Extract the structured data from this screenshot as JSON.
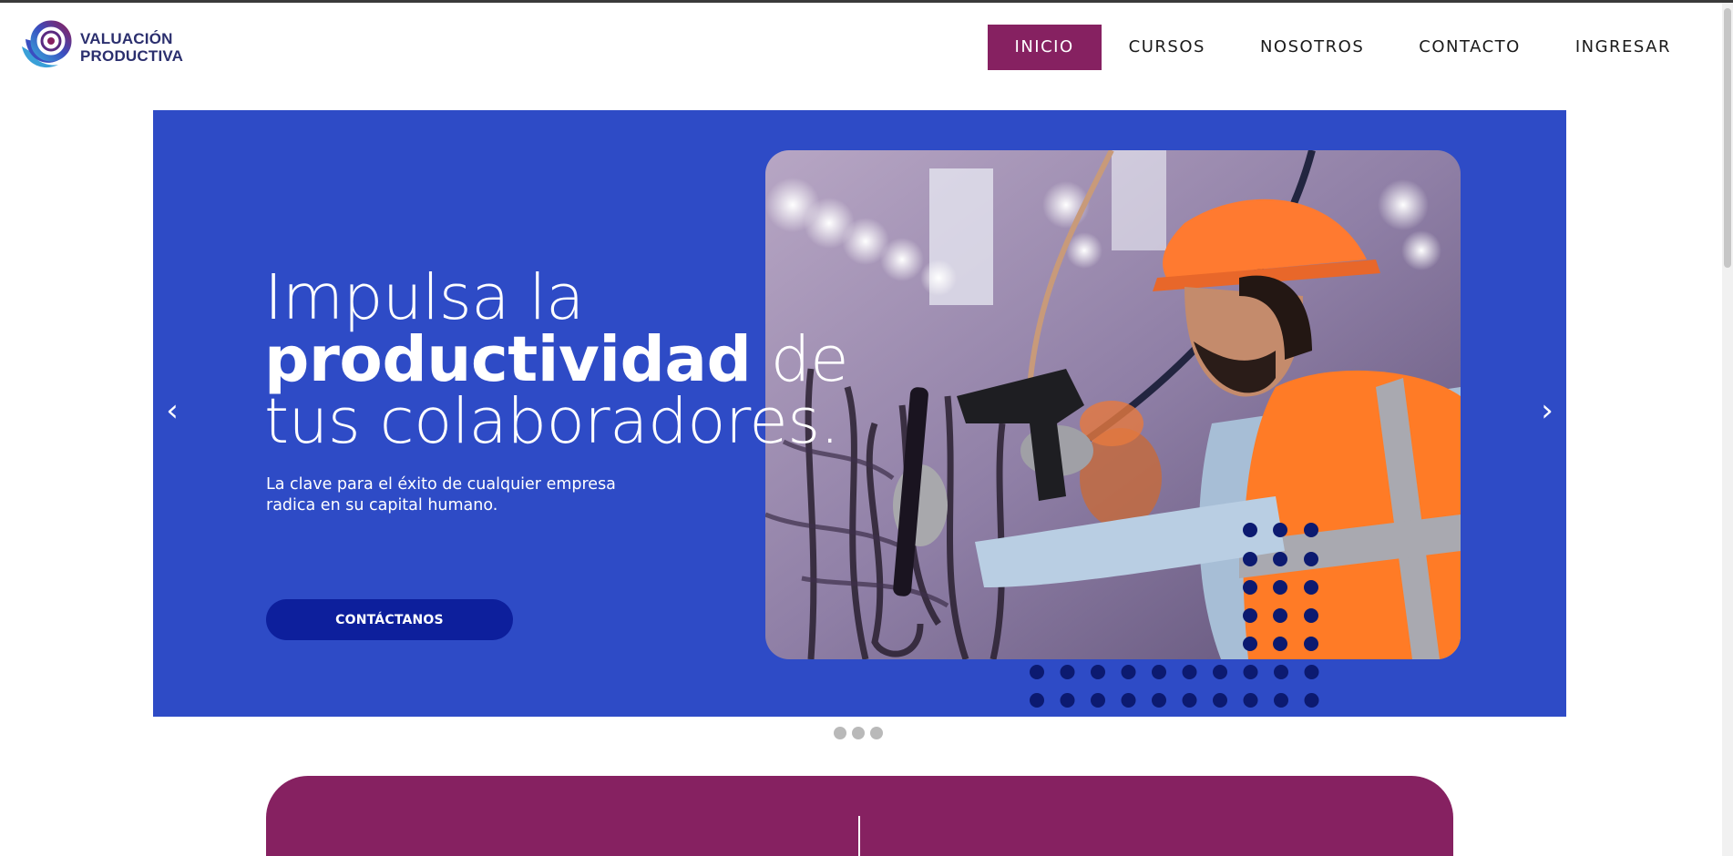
{
  "header": {
    "logo_line1": "VALUACIÓN",
    "logo_line2": "PRODUCTIVA",
    "nav": [
      {
        "label": "INICIO",
        "active": true
      },
      {
        "label": "CURSOS",
        "active": false
      },
      {
        "label": "NOSOTROS",
        "active": false
      },
      {
        "label": "CONTACTO",
        "active": false
      },
      {
        "label": "INGRESAR",
        "active": false
      }
    ]
  },
  "hero": {
    "title_line1": "Impulsa la",
    "title_bold": "productividad",
    "title_after_bold": " de",
    "title_line3": "tus colaboradores.",
    "subtitle_line1": "La clave para el éxito de cualquier empresa",
    "subtitle_line2": "radica en su capital humano.",
    "cta_label": "CONTÁCTANOS",
    "prev_arrow": "‹",
    "next_arrow": "›",
    "image": "worker-with-hard-hat-and-drill-photo",
    "background_color": "#2e4bc6"
  },
  "carousel": {
    "slides": 3
  },
  "colors": {
    "accent": "#862161",
    "brand_blue": "#2e4bc6",
    "button_blue": "#0d1f9c",
    "dot_navy": "#0c1a70"
  },
  "icons": [
    "valuacion-productiva-logo-icon",
    "chevron-left-icon",
    "chevron-right-icon"
  ]
}
